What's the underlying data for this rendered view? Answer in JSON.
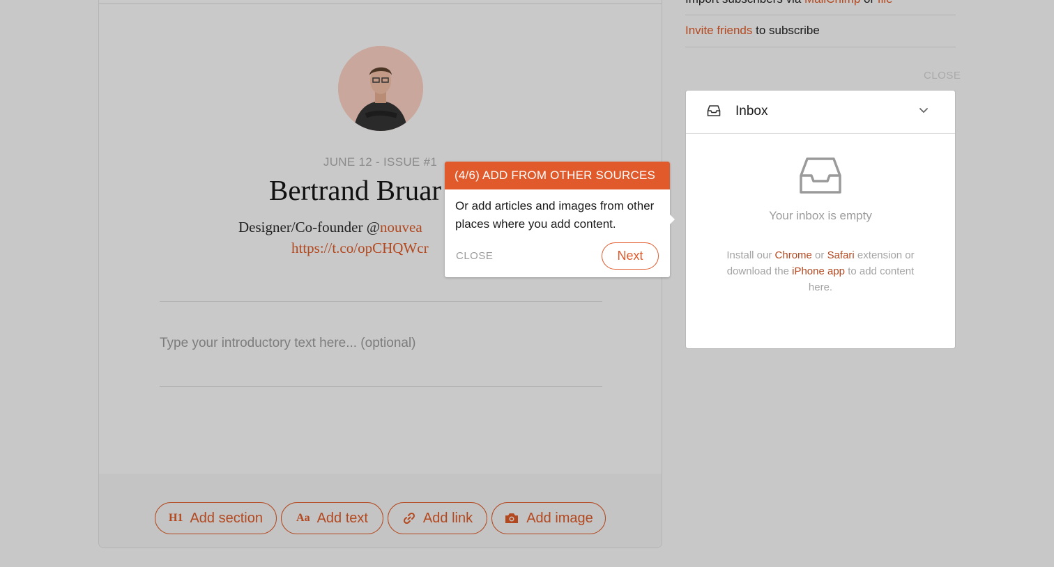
{
  "colors": {
    "accent": "#b3481f",
    "tooltip_header": "#e05a2b",
    "overlay_bg": "#c8c8c8"
  },
  "profile": {
    "issue_line": "JUNE 12 - ISSUE #1",
    "name": "Bertrand Bruar",
    "bio_prefix": "Designer/Co-founder @",
    "bio_handle": "nouvea",
    "bio_link": "https://t.co/opCHQWcr"
  },
  "editor": {
    "intro_placeholder": "Type your introductory text here... (optional)",
    "toolbar": [
      {
        "icon": "H1",
        "label": "Add section"
      },
      {
        "icon": "Aa",
        "label": "Add text"
      },
      {
        "icon": "link-icon",
        "label": "Add link"
      },
      {
        "icon": "camera-icon",
        "label": "Add image"
      }
    ]
  },
  "sidebar": {
    "import_prefix": "Import subscribers via ",
    "import_mailchimp": "MailChimp",
    "import_or": " or ",
    "import_file": "file",
    "invite_link": "Invite friends",
    "invite_suffix": " to subscribe",
    "close_label": "CLOSE",
    "inbox": {
      "title": "Inbox",
      "empty_text": "Your inbox is empty",
      "help_1": "Install our ",
      "help_chrome": "Chrome",
      "help_or": " or ",
      "help_safari": "Safari",
      "help_2": " extension or download the ",
      "help_iphone": "iPhone app",
      "help_3": " to add content here."
    }
  },
  "tooltip": {
    "header": "(4/6) ADD FROM OTHER SOURCES",
    "body": "Or add articles and images from other places where you add content.",
    "close_label": "CLOSE",
    "next_label": "Next"
  }
}
